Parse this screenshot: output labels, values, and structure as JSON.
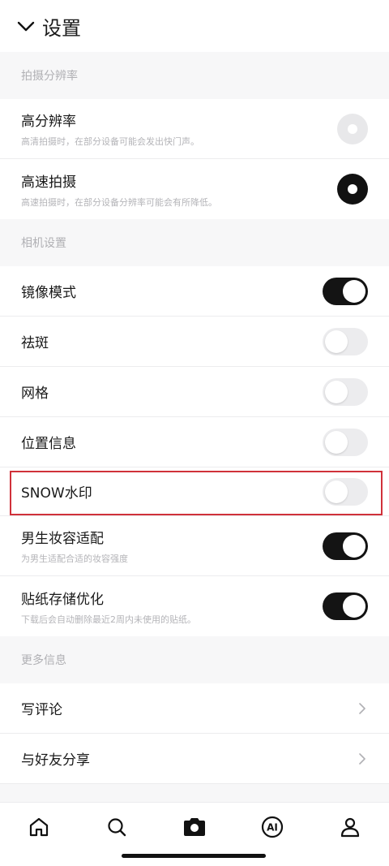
{
  "header": {
    "title": "设置",
    "back_icon": "chevron-down-icon"
  },
  "sections": {
    "capture": "拍摄分辨率",
    "camera": "相机设置",
    "more": "更多信息"
  },
  "capture": {
    "high_res": {
      "label": "高分辨率",
      "sub": "高清拍摄时，在部分设备可能会发出快门声。",
      "selected": false
    },
    "high_speed": {
      "label": "高速拍摄",
      "sub": "高速拍摄时，在部分设备分辨率可能会有所降低。",
      "selected": true
    }
  },
  "camera": {
    "mirror": {
      "label": "镜像模式",
      "on": true
    },
    "blemish": {
      "label": "祛斑",
      "on": false
    },
    "grid": {
      "label": "网格",
      "on": false
    },
    "location": {
      "label": "位置信息",
      "on": false
    },
    "watermark": {
      "label": "SNOW水印",
      "on": false
    },
    "male_makeup": {
      "label": "男生妆容适配",
      "sub": "为男生适配合适的妆容强度",
      "on": true
    },
    "sticker_storage": {
      "label": "贴纸存储优化",
      "sub": "下载后会自动删除最近2周内未使用的贴纸。",
      "on": true
    }
  },
  "more": {
    "review": {
      "label": "写评论"
    },
    "share": {
      "label": "与好友分享"
    }
  },
  "bottom_nav": [
    "home-icon",
    "search-icon",
    "camera-icon",
    "ai-icon",
    "profile-icon"
  ],
  "colors": {
    "accent": "#141414",
    "highlight": "#d0313a",
    "toggle_off": "#ececee"
  }
}
